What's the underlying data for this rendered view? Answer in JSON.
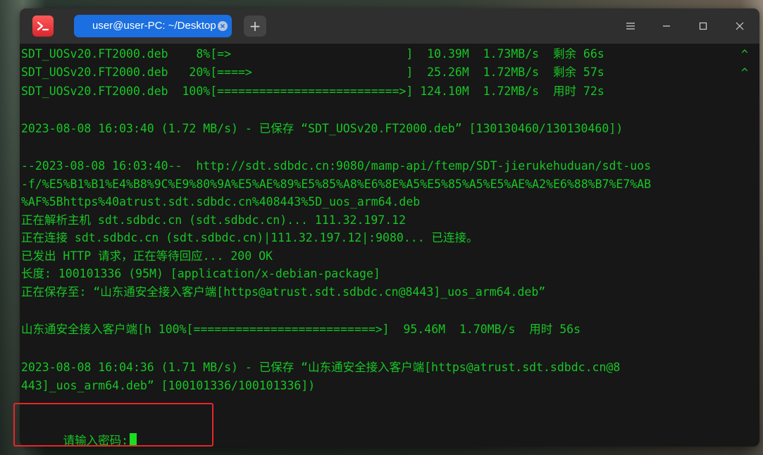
{
  "window": {
    "tab_title": "user@user-PC: ~/Desktop",
    "new_tab_symbol": "+",
    "menu_symbol": "≡",
    "minimize_symbol": "—",
    "maximize_symbol": "□",
    "close_symbol": "✕"
  },
  "terminal": {
    "lines": [
      "SDT_UOSv20.FT2000.deb    8%[=>                         ]  10.39M  1.73MB/s  剩余 66s",
      "SDT_UOSv20.FT2000.deb   20%[====>                      ]  25.26M  1.72MB/s  剩余 57s",
      "SDT_UOSv20.FT2000.deb  100%[==========================>] 124.10M  1.72MB/s  用时 72s",
      "",
      "2023-08-08 16:03:40 (1.72 MB/s) - 已保存 “SDT_UOSv20.FT2000.deb” [130130460/130130460])",
      "",
      "--2023-08-08 16:03:40--  http://sdt.sdbdc.cn:9080/mamp-api/ftemp/SDT-jierukehuduan/sdt-uos",
      "-f/%E5%B1%B1%E4%B8%9C%E9%80%9A%E5%AE%89%E5%85%A8%E6%8E%A5%E5%85%A5%E5%AE%A2%E6%88%B7%E7%AB",
      "%AF%5Bhttps%40atrust.sdt.sdbdc.cn%408443%5D_uos_arm64.deb",
      "正在解析主机 sdt.sdbdc.cn (sdt.sdbdc.cn)... 111.32.197.12",
      "正在连接 sdt.sdbdc.cn (sdt.sdbdc.cn)|111.32.197.12|:9080... 已连接。",
      "已发出 HTTP 请求，正在等待回应... 200 OK",
      "长度: 100101336 (95M) [application/x-debian-package]",
      "正在保存至: “山东通安全接入客户端[https@atrust.sdt.sdbdc.cn@8443]_uos_arm64.deb”",
      "",
      "山东通安全接入客户端[h 100%[==========================>]  95.46M  1.70MB/s  用时 56s",
      "",
      "2023-08-08 16:04:36 (1.71 MB/s) - 已保存 “山东通安全接入客户端[https@atrust.sdt.sdbdc.cn@8",
      "443]_uos_arm64.deb” [100101336/100101336])",
      "",
      "请输入密码:"
    ],
    "scroll_indicators": [
      "^",
      "^"
    ],
    "text_color": "#18c526",
    "background_color": "#171717"
  },
  "colors": {
    "tab_active": "#1b6fe0",
    "highlight_box": "#e8252a"
  }
}
